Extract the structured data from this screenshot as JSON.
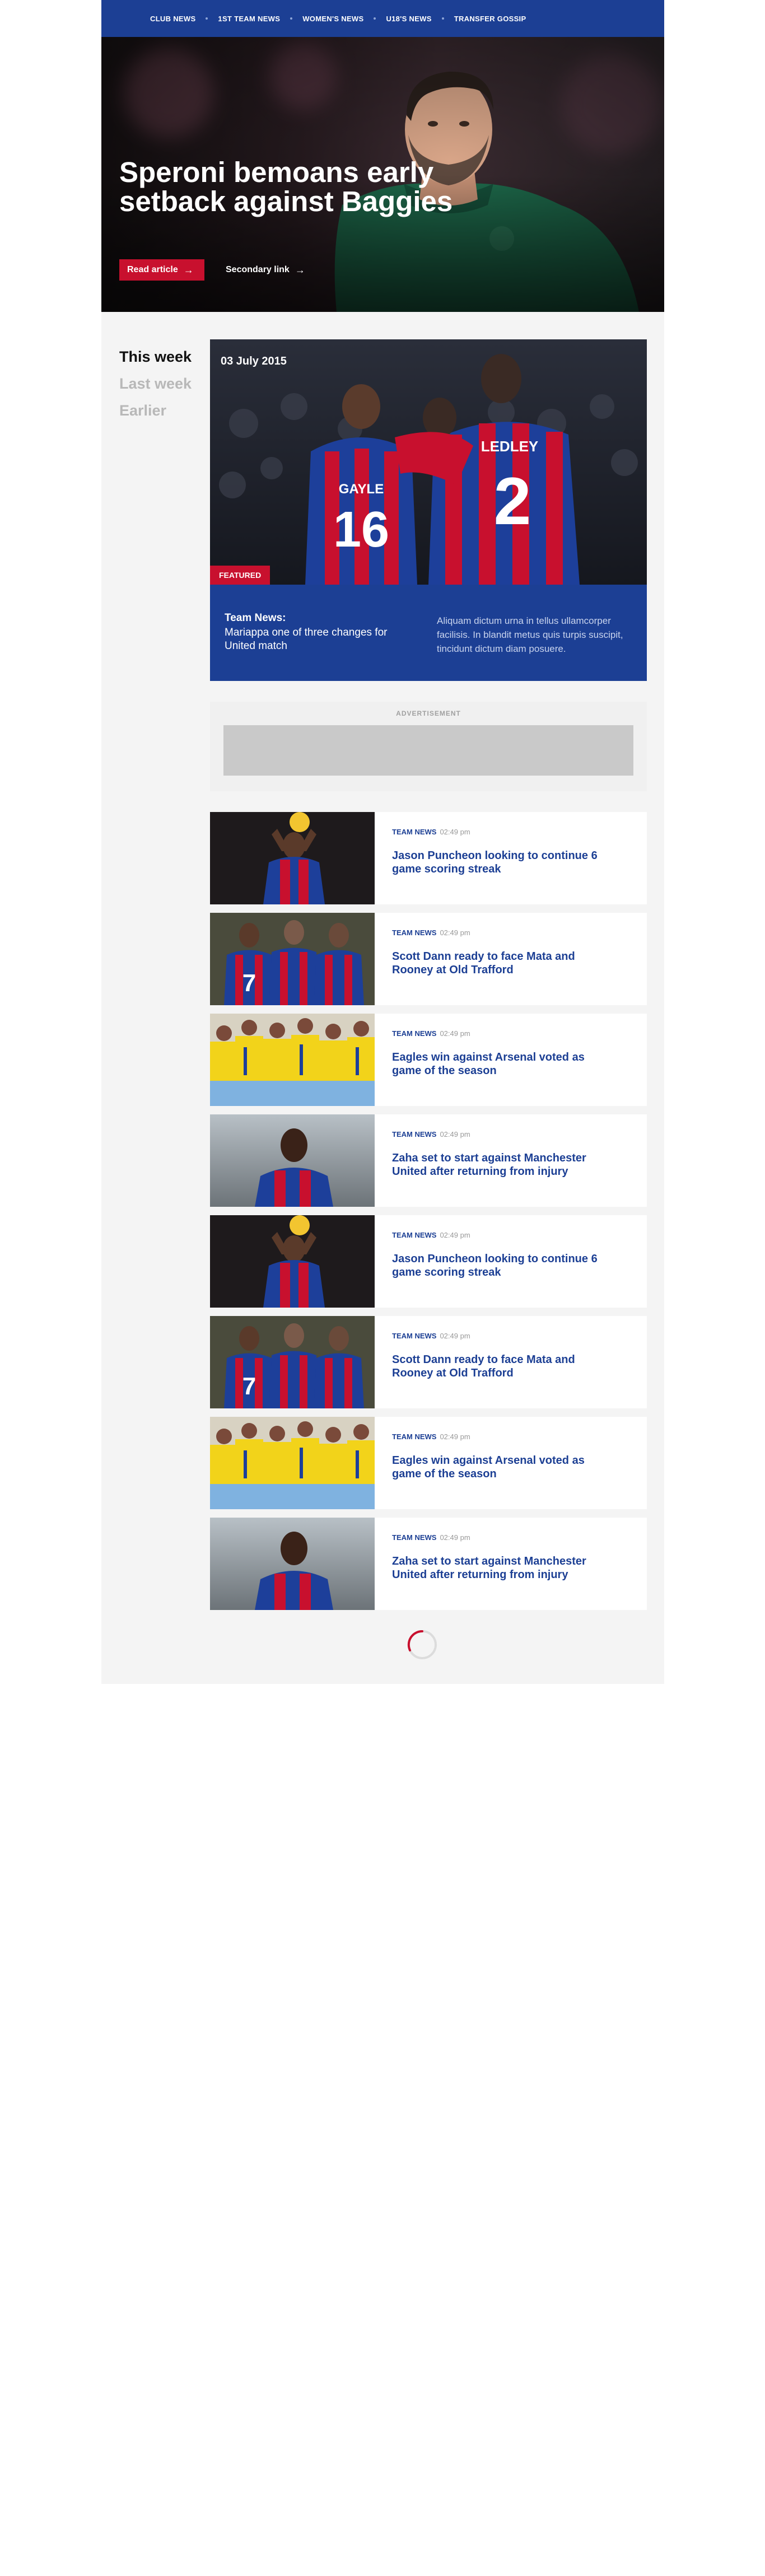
{
  "nav": {
    "items": [
      "Club News",
      "1st Team News",
      "Women's News",
      "U18's News",
      "Transfer Gossip"
    ]
  },
  "hero": {
    "title": "Speroni bemoans early setback against Baggies",
    "primary_button": "Read article",
    "secondary_link": "Secondary link"
  },
  "sidebar": {
    "items": [
      "This week",
      "Last week",
      "Earlier"
    ]
  },
  "featured": {
    "date": "03 July 2015",
    "badge": "FEATURED",
    "category": "Team News:",
    "headline": "Mariappa one of three changes for United match",
    "description": "Aliquam dictum urna in tellus ullamcorper facilisis. In blandit metus quis turpis suscipit, tincidunt dictum diam posuere."
  },
  "advert": {
    "label": "ADVERTISEMENT"
  },
  "articles": [
    {
      "category": "Team News",
      "time": "02:49 pm",
      "title": "Jason Puncheon looking to continue 6 game scoring streak"
    },
    {
      "category": "Team News",
      "time": "02:49 pm",
      "title": "Scott Dann ready to face Mata and Rooney at Old Trafford"
    },
    {
      "category": "Team News",
      "time": "02:49 pm",
      "title": "Eagles win against Arsenal voted as game of the season"
    },
    {
      "category": "Team News",
      "time": "02:49 pm",
      "title": "Zaha set to start against Manchester United after returning from injury"
    },
    {
      "category": "Team News",
      "time": "02:49 pm",
      "title": "Jason Puncheon looking to continue 6 game scoring streak"
    },
    {
      "category": "Team News",
      "time": "02:49 pm",
      "title": "Scott Dann ready to face Mata and Rooney at Old Trafford"
    },
    {
      "category": "Team News",
      "time": "02:49 pm",
      "title": "Eagles win against Arsenal voted as game of the season"
    },
    {
      "category": "Team News",
      "time": "02:49 pm",
      "title": "Zaha set to start against Manchester United after returning from injury"
    }
  ],
  "colors": {
    "brand_blue": "#1c3f94",
    "brand_red": "#c8102e",
    "page_bg": "#f4f4f4"
  },
  "icons": {
    "arrow": "arrow-right-icon",
    "loader": "spinner-icon"
  }
}
